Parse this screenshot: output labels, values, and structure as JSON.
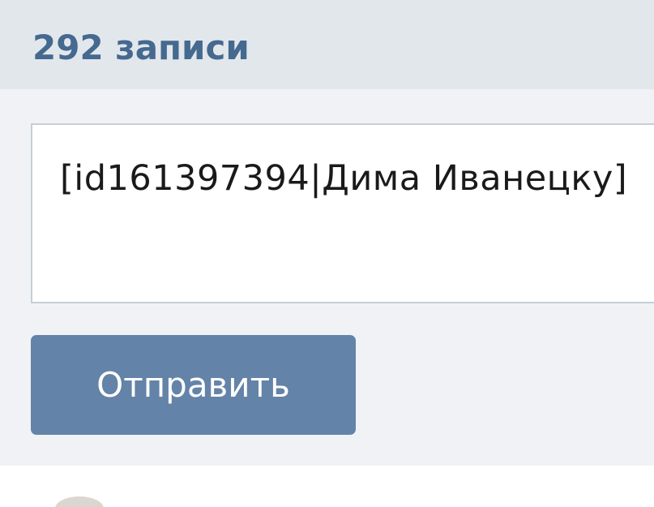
{
  "wall": {
    "count_label": "292 записи"
  },
  "composer": {
    "input_value": "[id161397394|Дима Иванецку]"
  },
  "actions": {
    "send_label": "Отправить"
  },
  "colors": {
    "header_bg": "#e2e7ec",
    "count_text": "#45698f",
    "compose_bg": "#f0f2f5",
    "button_bg": "#6483a8"
  }
}
